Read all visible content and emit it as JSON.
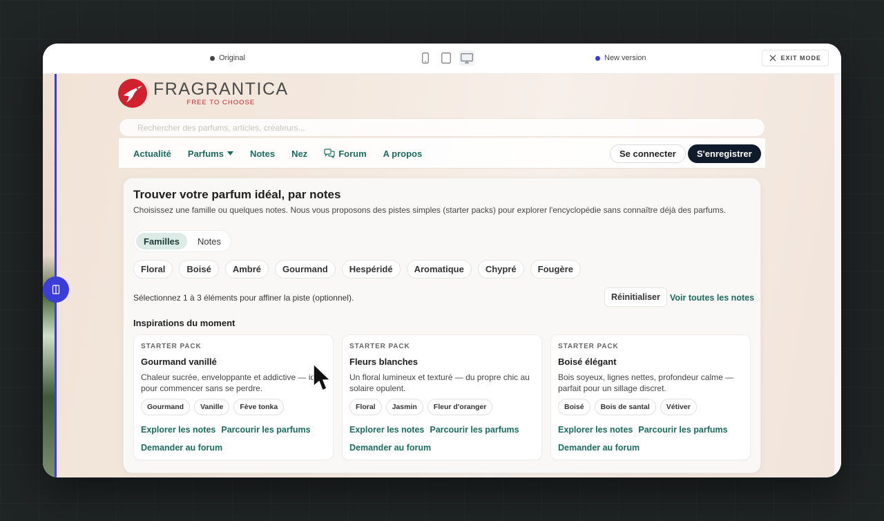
{
  "compare": {
    "original_label": "Original",
    "new_label": "New version",
    "exit_label": "EXIT MODE",
    "original_dot_color": "#444444",
    "new_dot_color": "#3a3dd6",
    "devices": [
      "mobile-icon",
      "tablet-icon",
      "desktop-icon"
    ],
    "active_device": "desktop"
  },
  "brand": {
    "name": "FRAGRANTICA",
    "tagline": "FREE TO CHOOSE",
    "logo_color": "#d0222e"
  },
  "search": {
    "placeholder": "Rechercher des parfums, articles, créateurs..."
  },
  "nav": {
    "items": [
      {
        "label": "Actualité"
      },
      {
        "label": "Parfums"
      },
      {
        "label": "Notes"
      },
      {
        "label": "Nez"
      },
      {
        "label": "Forum"
      },
      {
        "label": "A propos"
      }
    ],
    "login": "Se connecter",
    "signup": "S'enregistrer",
    "accent_color": "#1c6b60"
  },
  "finder": {
    "title": "Trouver votre parfum idéal, par notes",
    "description": "Choisissez une famille ou quelques notes. Nous vous proposons des pistes simples (starter packs) pour explorer l'encyclopédie sans connaître déjà des parfums.",
    "tabs": [
      {
        "label": "Familles",
        "active": true
      },
      {
        "label": "Notes",
        "active": false
      }
    ],
    "families": [
      "Floral",
      "Boisé",
      "Ambré",
      "Gourmand",
      "Hespéridé",
      "Aromatique",
      "Chypré",
      "Fougère"
    ],
    "hint": "Sélectionnez 1 à 3 éléments pour affiner la piste (optionnel).",
    "reset": "Réinitialiser",
    "see_all": "Voir toutes les notes",
    "inspirations_title": "Inspirations du moment"
  },
  "cards": [
    {
      "kicker": "STARTER PACK",
      "title": "Gourmand vanillé",
      "desc": "Chaleur sucrée, enveloppante et addictive — idéal pour commencer sans se perdre.",
      "tags": [
        "Gourmand",
        "Vanille",
        "Fève tonka"
      ],
      "link1": "Explorer les notes",
      "link2": "Parcourir les parfums",
      "forum": "Demander au forum"
    },
    {
      "kicker": "STARTER PACK",
      "title": "Fleurs blanches",
      "desc": "Un floral lumineux et texturé — du propre chic au solaire opulent.",
      "tags": [
        "Floral",
        "Jasmin",
        "Fleur d'oranger"
      ],
      "link1": "Explorer les notes",
      "link2": "Parcourir les parfums",
      "forum": "Demander au forum"
    },
    {
      "kicker": "STARTER PACK",
      "title": "Boisé élégant",
      "desc": "Bois soyeux, lignes nettes, profondeur calme — parfait pour un sillage discret.",
      "tags": [
        "Boisé",
        "Bois de santal",
        "Vétiver"
      ],
      "link1": "Explorer les notes",
      "link2": "Parcourir les parfums",
      "forum": "Demander au forum"
    }
  ]
}
